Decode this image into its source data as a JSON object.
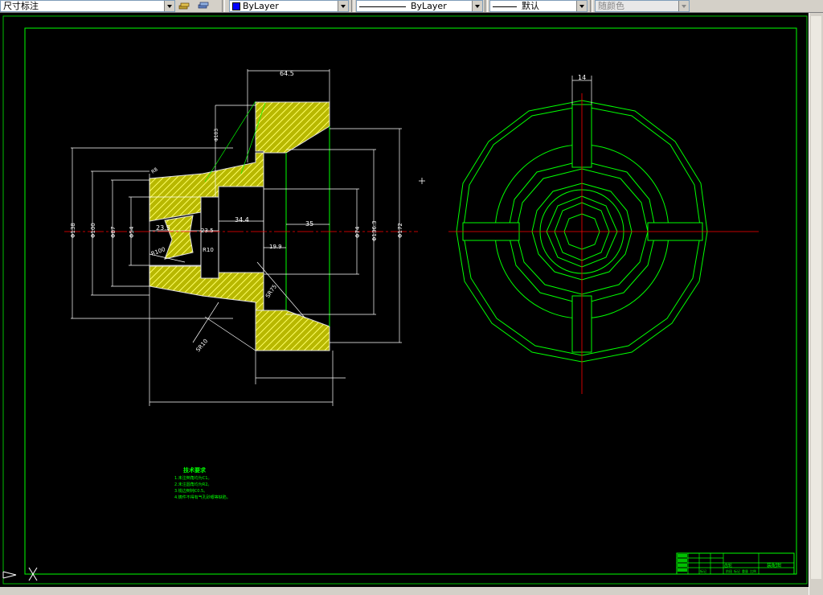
{
  "toolbar": {
    "dimstyle_value": "尺寸标注",
    "color_value": "ByLayer",
    "linetype_value": "ByLayer",
    "lineweight_value": "默认",
    "plotstyle_value": "随颜色"
  },
  "drawing": {
    "dimensions": {
      "d_64_5": "64.5",
      "d_14": "14",
      "d_34_4": "34.4",
      "d_35": "35",
      "d_19_9": "19.9",
      "d_23_5a": "23.5",
      "d_23_5b": "23.5",
      "d_R10": "R10",
      "d_R8": "R8",
      "d_R100": "R100",
      "d_SR75": "SR75",
      "d_SR10": "SR10",
      "d_phi138": "Φ138",
      "d_phi100": "Φ100",
      "d_phi87": "Φ87",
      "d_phi54": "Φ54",
      "d_phi74": "Φ74",
      "d_phi136_3": "Φ136.3",
      "d_phi172": "Φ172",
      "d_phi103": "Φ103"
    },
    "notes_title": "技术要求",
    "notes": [
      "1.未注倒角均为C1。",
      "2.未注圆角均为R2。",
      "3.锐边倒钝C0.5。",
      "4.铸件不得有气孔砂眼等缺陷。"
    ],
    "title_block": {
      "part_name": "齿轮",
      "drawing_no": "装配图",
      "row_labels": [
        "标记",
        "设计",
        "审核",
        "工艺"
      ],
      "stage_labels": [
        "阶段",
        "标记",
        "重量",
        "比例"
      ]
    }
  },
  "colors": {
    "background": "#000000",
    "border": "#00ff00",
    "hatch_fill": "#c8c800",
    "dimension": "#ffffff",
    "centerline": "#ff0000",
    "text_green": "#00ff00"
  }
}
